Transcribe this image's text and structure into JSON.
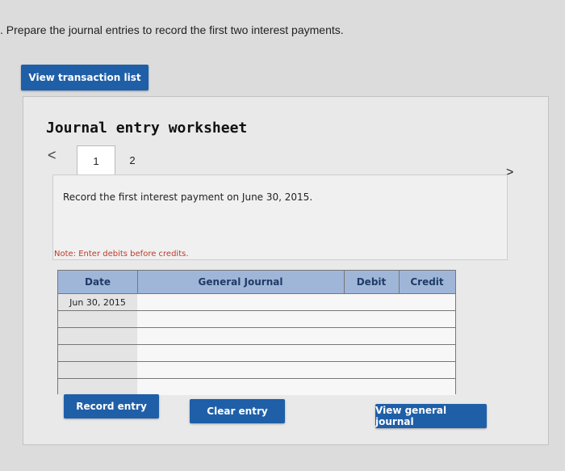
{
  "question": ". Prepare the journal entries to record the first two interest payments.",
  "view_transaction_list": "View transaction list",
  "worksheet": {
    "title": "Journal entry worksheet",
    "tabs": [
      "1",
      "2"
    ],
    "nav_prev": "<",
    "nav_next": ">",
    "description": "Record the first interest payment on June 30, 2015.",
    "note": "Note: Enter debits before credits.",
    "table": {
      "headers": {
        "date": "Date",
        "general_journal": "General Journal",
        "debit": "Debit",
        "credit": "Credit"
      },
      "rows": [
        {
          "date": "Jun 30, 2015",
          "gj": "",
          "debit": "",
          "credit": ""
        },
        {
          "date": "",
          "gj": "",
          "debit": "",
          "credit": ""
        },
        {
          "date": "",
          "gj": "",
          "debit": "",
          "credit": ""
        },
        {
          "date": "",
          "gj": "",
          "debit": "",
          "credit": ""
        },
        {
          "date": "",
          "gj": "",
          "debit": "",
          "credit": ""
        },
        {
          "date": "",
          "gj": "",
          "debit": "",
          "credit": ""
        }
      ]
    },
    "buttons": {
      "record": "Record entry",
      "clear": "Clear entry",
      "view_gj": "View general journal"
    }
  }
}
